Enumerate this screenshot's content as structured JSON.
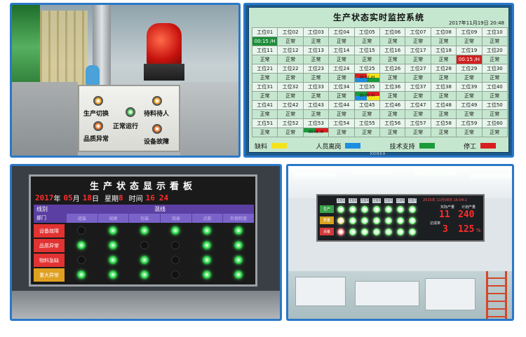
{
  "panel1": {
    "buttons": [
      {
        "label": "生产切换",
        "color": "#f0a020"
      },
      {
        "label": "正常运行",
        "color": "#3ec04a"
      },
      {
        "label": "待料待人",
        "color": "#f0a020"
      },
      {
        "label": "品质异常",
        "color": "#f07020"
      },
      {
        "label": "设备故障",
        "color": "#f07020"
      }
    ]
  },
  "panel2": {
    "title": "生产状态实时监控系统",
    "datetime": "2017年11月19日  20:48",
    "brand": "KONKA",
    "stations": [
      {
        "name": "工位01",
        "status": "00:15 /H",
        "state": "green"
      },
      {
        "name": "工位02",
        "status": "正常",
        "state": "normal"
      },
      {
        "name": "工位03",
        "status": "正常",
        "state": "normal"
      },
      {
        "name": "工位04",
        "status": "正常",
        "state": "normal"
      },
      {
        "name": "工位05",
        "status": "正常",
        "state": "normal"
      },
      {
        "name": "工位06",
        "status": "正常",
        "state": "normal"
      },
      {
        "name": "工位07",
        "status": "正常",
        "state": "normal"
      },
      {
        "name": "工位08",
        "status": "正常",
        "state": "normal"
      },
      {
        "name": "工位09",
        "status": "正常",
        "state": "normal"
      },
      {
        "name": "工位10",
        "status": "正常",
        "state": "normal"
      },
      {
        "name": "工位11",
        "status": "正常",
        "state": "normal"
      },
      {
        "name": "工位12",
        "status": "正常",
        "state": "normal"
      },
      {
        "name": "工位13",
        "status": "正常",
        "state": "normal"
      },
      {
        "name": "工位14",
        "status": "正常",
        "state": "normal"
      },
      {
        "name": "工位15",
        "status": "正常",
        "state": "normal"
      },
      {
        "name": "工位16",
        "status": "正常",
        "state": "normal"
      },
      {
        "name": "工位17",
        "status": "正常",
        "state": "normal"
      },
      {
        "name": "工位18",
        "status": "正常",
        "state": "normal"
      },
      {
        "name": "工位19",
        "status": "00:15 /H",
        "state": "red"
      },
      {
        "name": "工位20",
        "status": "正常",
        "state": "normal"
      },
      {
        "name": "工位21",
        "status": "正常",
        "state": "normal"
      },
      {
        "name": "工位22",
        "status": "正常",
        "state": "normal"
      },
      {
        "name": "工位23",
        "status": "正常",
        "state": "normal"
      },
      {
        "name": "工位24",
        "status": "正常",
        "state": "normal"
      },
      {
        "name": "工位25",
        "status": "00:02 /H",
        "state": "multi"
      },
      {
        "name": "工位26",
        "status": "正常",
        "state": "normal"
      },
      {
        "name": "工位27",
        "status": "正常",
        "state": "normal"
      },
      {
        "name": "工位28",
        "status": "正常",
        "state": "normal"
      },
      {
        "name": "工位29",
        "status": "正常",
        "state": "normal"
      },
      {
        "name": "工位30",
        "status": "正常",
        "state": "normal"
      },
      {
        "name": "工位31",
        "status": "正常",
        "state": "normal"
      },
      {
        "name": "工位32",
        "status": "正常",
        "state": "normal"
      },
      {
        "name": "工位33",
        "status": "正常",
        "state": "normal"
      },
      {
        "name": "工位34",
        "status": "正常",
        "state": "normal"
      },
      {
        "name": "工位35",
        "status": "00:03 /H",
        "state": "multi2"
      },
      {
        "name": "工位36",
        "status": "正常",
        "state": "normal"
      },
      {
        "name": "工位37",
        "status": "正常",
        "state": "normal"
      },
      {
        "name": "工位38",
        "status": "正常",
        "state": "normal"
      },
      {
        "name": "工位39",
        "status": "正常",
        "state": "normal"
      },
      {
        "name": "工位40",
        "status": "正常",
        "state": "normal"
      },
      {
        "name": "工位41",
        "status": "正常",
        "state": "normal"
      },
      {
        "name": "工位42",
        "status": "正常",
        "state": "normal"
      },
      {
        "name": "工位43",
        "status": "正常",
        "state": "normal"
      },
      {
        "name": "工位44",
        "status": "正常",
        "state": "normal"
      },
      {
        "name": "工位45",
        "status": "正常",
        "state": "normal"
      },
      {
        "name": "工位46",
        "status": "正常",
        "state": "normal"
      },
      {
        "name": "工位47",
        "status": "正常",
        "state": "normal"
      },
      {
        "name": "工位48",
        "status": "正常",
        "state": "normal"
      },
      {
        "name": "工位49",
        "status": "正常",
        "state": "normal"
      },
      {
        "name": "工位50",
        "status": "正常",
        "state": "normal"
      },
      {
        "name": "工位51",
        "status": "正常",
        "state": "normal"
      },
      {
        "name": "工位52",
        "status": "正常",
        "state": "normal"
      },
      {
        "name": "工位53",
        "status": "00:06 /H",
        "state": "multi3"
      },
      {
        "name": "工位54",
        "status": "正常",
        "state": "normal"
      },
      {
        "name": "工位55",
        "status": "正常",
        "state": "normal"
      },
      {
        "name": "工位56",
        "status": "正常",
        "state": "normal"
      },
      {
        "name": "工位57",
        "status": "正常",
        "state": "normal"
      },
      {
        "name": "工位58",
        "status": "正常",
        "state": "normal"
      },
      {
        "name": "工位59",
        "status": "正常",
        "state": "normal"
      },
      {
        "name": "工位60",
        "status": "正常",
        "state": "normal"
      }
    ],
    "legend": [
      {
        "label": "缺料",
        "color": "#f5e31a"
      },
      {
        "label": "人员离岗",
        "color": "#1e8de0"
      },
      {
        "label": "技术支持",
        "color": "#1a9a3a"
      },
      {
        "label": "停工",
        "color": "#d81e1e"
      }
    ]
  },
  "panel3": {
    "title": "生产状态显示看板",
    "year": "2017",
    "year_unit": "年",
    "month": "05",
    "month_unit": "月",
    "day": "18",
    "day_unit": "日",
    "weekday_label": "星期",
    "weekday": "8",
    "time_label": "时间",
    "hour": "16",
    "minute": "24",
    "line_header": "线别",
    "line_name": "混线",
    "dept_header": "部门",
    "sub_headers": [
      "组装",
      "线尾",
      "包装",
      "烧录",
      "点胶",
      "外观检查"
    ],
    "rows": [
      {
        "label": "设备故障",
        "style": "red",
        "leds": [
          0,
          1,
          1,
          1,
          1,
          1
        ]
      },
      {
        "label": "品质异常",
        "style": "red",
        "leds": [
          1,
          1,
          0,
          0,
          1,
          1
        ]
      },
      {
        "label": "物料急缺",
        "style": "red",
        "leds": [
          0,
          1,
          1,
          0,
          1,
          1
        ]
      },
      {
        "label": "重大异常",
        "style": "yellow",
        "leds": [
          1,
          1,
          1,
          0,
          1,
          1
        ]
      }
    ]
  },
  "panel4": {
    "col_headers": [
      "工位1",
      "工位2",
      "工位3",
      "工位4",
      "工位5",
      "工位6",
      "工位7"
    ],
    "row_headers": [
      "生产",
      "质量",
      "设备"
    ],
    "datetime": "2015年 11月08日 16:04:1",
    "plan_label": "计划产量",
    "plan_value": "240",
    "actual_label": "实际产量",
    "actual_value": "11",
    "rate_label": "达成率",
    "rate_value": "125",
    "rate_unit": "%",
    "diff_value": "3"
  }
}
